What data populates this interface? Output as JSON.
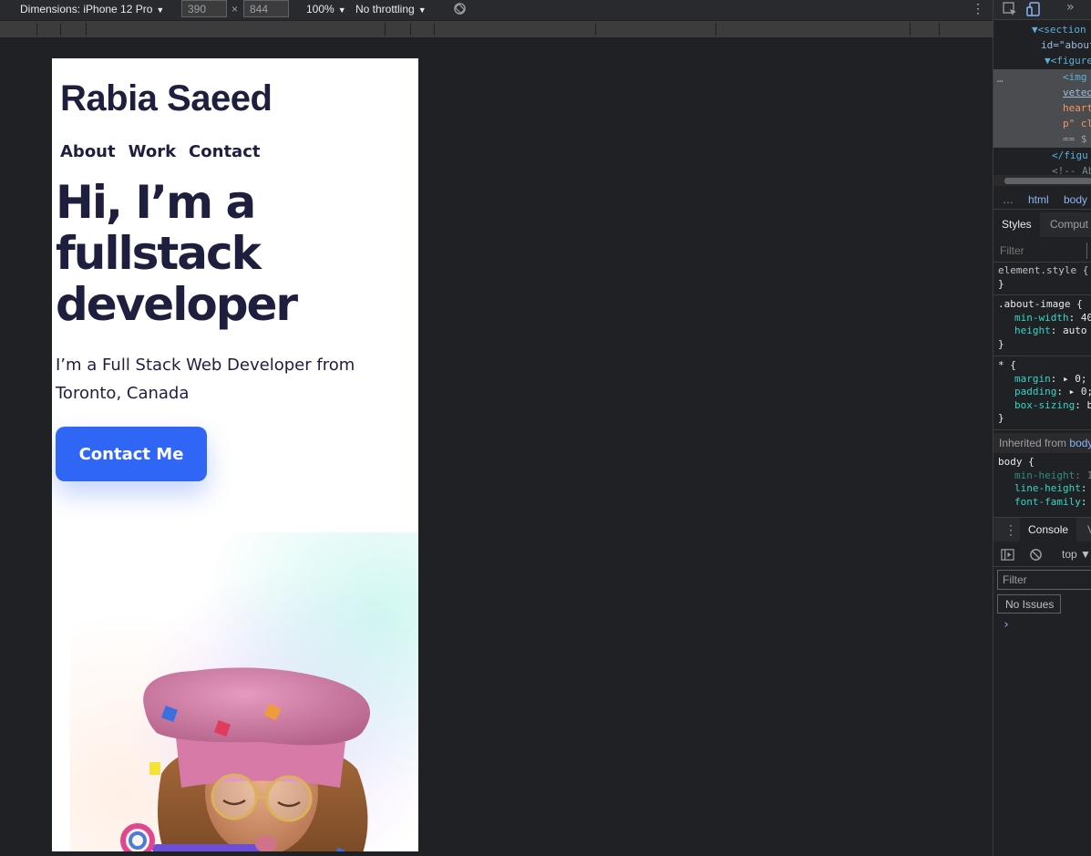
{
  "toolbar": {
    "device": "Dimensions: iPhone 12 Pro",
    "width": "390",
    "height": "844",
    "times": "×",
    "zoom": "100%",
    "throttling": "No throttling",
    "more": "⋮"
  },
  "site": {
    "logo": "Rabia Saeed",
    "nav": [
      "About",
      "Work",
      "Contact"
    ],
    "hero_lines": [
      "Hi, I’m a",
      "fullstack",
      "developer"
    ],
    "subtitle_lines": [
      "I’m a Full Stack Web Developer from",
      "Toronto, Canada"
    ],
    "cta": "Contact Me",
    "colors": {
      "text": "#1e1f3f",
      "cta": "#2f66f6"
    }
  },
  "devtools": {
    "dom": [
      {
        "indent": 0,
        "arrow": "▼",
        "text": "<section"
      },
      {
        "indent": 1,
        "arrow": "",
        "text": "id=\"about"
      },
      {
        "indent": 2,
        "arrow": "▼",
        "text": "<figure"
      },
      {
        "indent": 3,
        "arrow": "",
        "text": "<img"
      },
      {
        "indent": 3,
        "arrow": "",
        "text": "veted"
      },
      {
        "indent": 3,
        "arrow": "",
        "text": "heart"
      },
      {
        "indent": 3,
        "arrow": "",
        "text": "p\" cl"
      },
      {
        "indent": 3,
        "arrow": "",
        "text": " == $"
      },
      {
        "indent": 2,
        "arrow": "",
        "text": "</figu"
      },
      {
        "indent": 2,
        "arrow": "",
        "text": "<!-- Ab"
      }
    ],
    "dom_ellipsis": "…",
    "breadcrumbs": [
      "…",
      "html",
      "body"
    ],
    "tabs": [
      "Styles",
      "Comput"
    ],
    "filter_placeholder": "Filter",
    "rules": [
      {
        "selector": "element.style {",
        "props": [],
        "close": "}"
      },
      {
        "selector": ".about-image {",
        "props": [
          {
            "name": "min-width",
            "value": ": 40"
          },
          {
            "name": "height",
            "value": ": auto"
          }
        ],
        "close": "}"
      },
      {
        "selector": "* {",
        "props": [
          {
            "name": "margin",
            "value": ": ▸ 0;"
          },
          {
            "name": "padding",
            "value": ": ▸ 0;"
          },
          {
            "name": "box-sizing",
            "value": ": b"
          }
        ],
        "close": "}"
      }
    ],
    "inherited_label": "Inherited from",
    "inherited_link": "body",
    "body_rule": {
      "selector": "body {",
      "props": [
        {
          "name": "min-height",
          "value": ": 1"
        },
        {
          "name": "line-height",
          "value": ":"
        },
        {
          "name": "font-family",
          "value": ":"
        }
      ]
    },
    "drawer_tabs": [
      "Console",
      "V"
    ],
    "console_context": "top ▼",
    "console_filter": "Filter",
    "issues": "No Issues",
    "prompt": "›"
  }
}
